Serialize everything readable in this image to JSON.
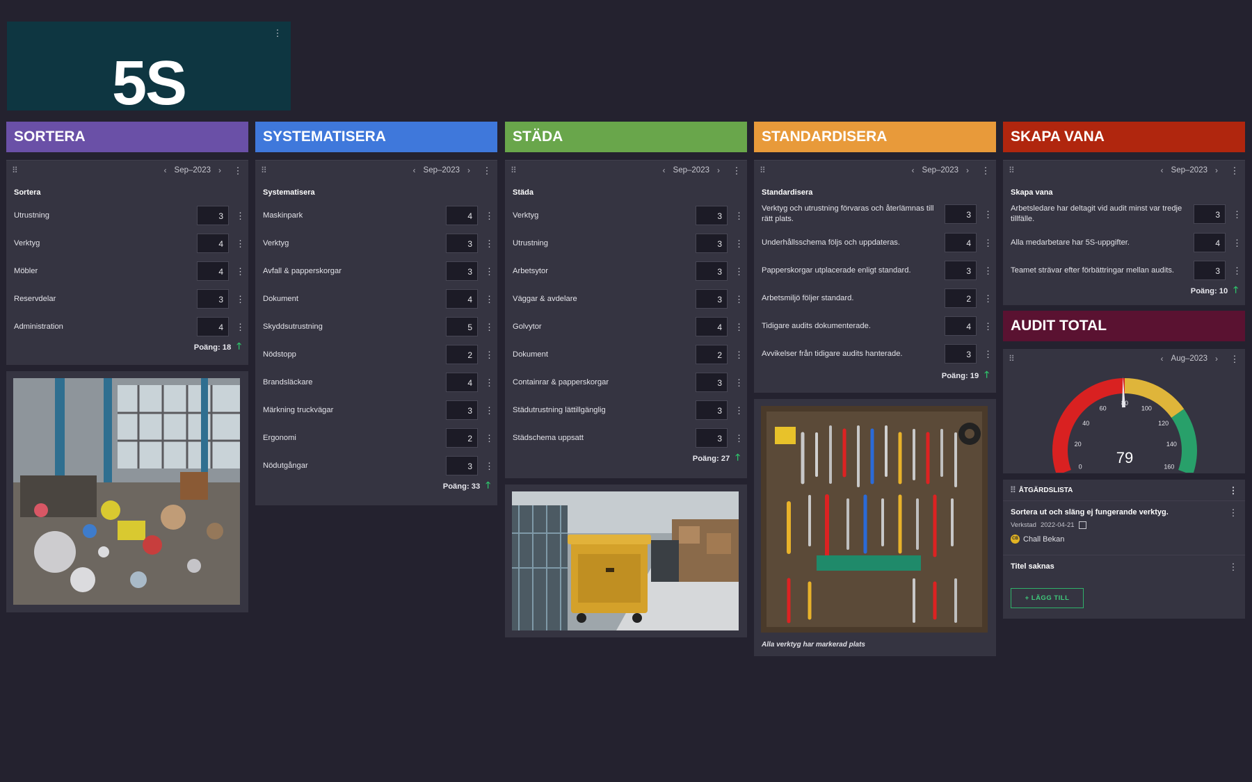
{
  "logo": {
    "text": "5S"
  },
  "colors": {
    "sortera": "#6a50a7",
    "systematisera": "#3f78db",
    "stada": "#69a64b",
    "standardisera": "#e89a3a",
    "skapa_vana": "#b0260e",
    "audit_total": "#5a1231"
  },
  "columns": [
    {
      "header": "SORTERA",
      "date": "Sep–2023",
      "title": "Sortera",
      "rows": [
        {
          "label": "Utrustning",
          "value": "3"
        },
        {
          "label": "Verktyg",
          "value": "4"
        },
        {
          "label": "Möbler",
          "value": "4"
        },
        {
          "label": "Reservdelar",
          "value": "3"
        },
        {
          "label": "Administration",
          "value": "4"
        }
      ],
      "score": "Poäng: 18"
    },
    {
      "header": "SYSTEMATISERA",
      "date": "Sep–2023",
      "title": "Systematisera",
      "rows": [
        {
          "label": "Maskinpark",
          "value": "4"
        },
        {
          "label": "Verktyg",
          "value": "3"
        },
        {
          "label": "Avfall & papperskorgar",
          "value": "3"
        },
        {
          "label": "Dokument",
          "value": "4"
        },
        {
          "label": "Skyddsutrustning",
          "value": "5"
        },
        {
          "label": "Nödstopp",
          "value": "2"
        },
        {
          "label": "Brandsläckare",
          "value": "4"
        },
        {
          "label": "Märkning truckvägar",
          "value": "3"
        },
        {
          "label": "Ergonomi",
          "value": "2"
        },
        {
          "label": "Nödutgångar",
          "value": "3"
        }
      ],
      "score": "Poäng: 33"
    },
    {
      "header": "STÄDA",
      "date": "Sep–2023",
      "title": "Städa",
      "rows": [
        {
          "label": "Verktyg",
          "value": "3"
        },
        {
          "label": "Utrustning",
          "value": "3"
        },
        {
          "label": "Arbetsytor",
          "value": "3"
        },
        {
          "label": "Väggar & avdelare",
          "value": "3"
        },
        {
          "label": "Golvytor",
          "value": "4"
        },
        {
          "label": "Dokument",
          "value": "2"
        },
        {
          "label": "Containrar & papperskorgar",
          "value": "3"
        },
        {
          "label": "Städutrustning lättillgänglig",
          "value": "3"
        },
        {
          "label": "Städschema uppsatt",
          "value": "3"
        }
      ],
      "score": "Poäng: 27"
    },
    {
      "header": "STANDARDISERA",
      "date": "Sep–2023",
      "title": "Standardisera",
      "rows": [
        {
          "label": "Verktyg och utrustning förvaras och återlämnas till rätt plats.",
          "value": "3"
        },
        {
          "label": "Underhållsschema följs och uppdateras.",
          "value": "4"
        },
        {
          "label": "Papperskorgar utplacerade enligt standard.",
          "value": "3"
        },
        {
          "label": "Arbetsmiljö följer standard.",
          "value": "2"
        },
        {
          "label": "Tidigare audits dokumenterade.",
          "value": "4"
        },
        {
          "label": "Avvikelser från tidigare audits hanterade.",
          "value": "3"
        }
      ],
      "score": "Poäng: 19",
      "caption": "Alla verktyg har markerad plats"
    },
    {
      "header": "SKAPA VANA",
      "date": "Sep–2023",
      "title": "Skapa vana",
      "rows": [
        {
          "label": "Arbetsledare har deltagit vid audit minst var tredje tillfälle.",
          "value": "3"
        },
        {
          "label": "Alla medarbetare har 5S-uppgifter.",
          "value": "4"
        },
        {
          "label": "Teamet strävar efter förbättringar mellan audits.",
          "value": "3"
        }
      ],
      "score": "Poäng: 10"
    }
  ],
  "audit": {
    "header": "AUDIT TOTAL",
    "date": "Aug–2023",
    "gauge": {
      "value": 79,
      "min": 0,
      "max": 160,
      "ticks": [
        "0",
        "20",
        "40",
        "60",
        "80",
        "100",
        "120",
        "140",
        "160"
      ],
      "bands": [
        {
          "from": 0,
          "to": 80,
          "color": "#d92121"
        },
        {
          "from": 80,
          "to": 120,
          "color": "#dfb53a"
        },
        {
          "from": 120,
          "to": 160,
          "color": "#28a06a"
        }
      ]
    }
  },
  "actions": {
    "title": "ÅTGÄRDSLISTA",
    "items": [
      {
        "title": "Sortera ut och släng ej fungerande verktyg.",
        "location": "Verkstad",
        "date": "2022-04-21",
        "owner_initials": "CB",
        "owner": "Chall Bekan"
      },
      {
        "title": "Titel saknas"
      }
    ],
    "add_label": "+ LÄGG TILL"
  },
  "icons": {
    "menu": "⋮",
    "drag": "⠿",
    "chevron_left": "‹",
    "chevron_right": "›",
    "arrow_up": "🡑"
  }
}
